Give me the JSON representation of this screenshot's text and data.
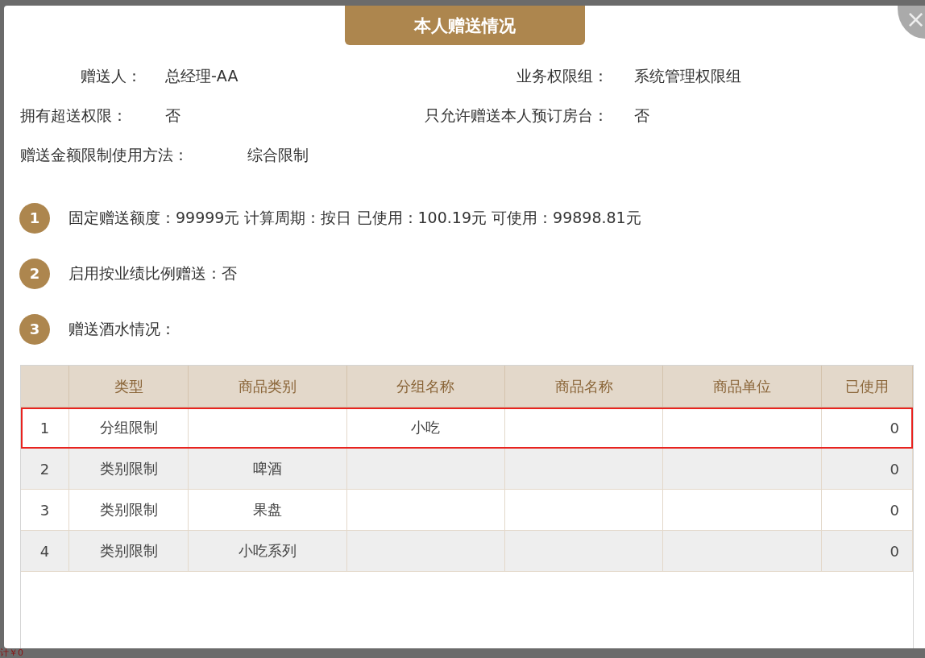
{
  "dialog": {
    "title": "本人赠送情况",
    "close": "×"
  },
  "info": [
    {
      "label": "赠送人：",
      "value": "总经理-AA",
      "label2": "业务权限组：",
      "value2": "系统管理权限组"
    },
    {
      "label": "拥有超送权限：",
      "value": "否",
      "label2": "只允许赠送本人预订房台：",
      "value2": "否"
    },
    {
      "label": "赠送金额限制使用方法：",
      "value": "综合限制"
    }
  ],
  "sections": [
    {
      "number": "1",
      "text": "固定赠送额度：99999元 计算周期：按日 已使用：100.19元 可使用：99898.81元"
    },
    {
      "number": "2",
      "text": "启用按业绩比例赠送：否"
    },
    {
      "number": "3",
      "text": "赠送酒水情况："
    }
  ],
  "table": {
    "columns": [
      "",
      "类型",
      "商品类别",
      "分组名称",
      "商品名称",
      "商品单位",
      "已使用"
    ],
    "rows": [
      {
        "selected": true,
        "cells": [
          "1",
          "分组限制",
          "",
          "小吃",
          "",
          "",
          "0"
        ]
      },
      {
        "selected": false,
        "cells": [
          "2",
          "类别限制",
          "啤酒",
          "",
          "",
          "",
          "0"
        ]
      },
      {
        "selected": false,
        "cells": [
          "3",
          "类别限制",
          "果盘",
          "",
          "",
          "",
          "0"
        ]
      },
      {
        "selected": false,
        "cells": [
          "4",
          "类别限制",
          "小吃系列",
          "",
          "",
          "",
          "0"
        ]
      }
    ]
  },
  "background_text": "计￥0"
}
